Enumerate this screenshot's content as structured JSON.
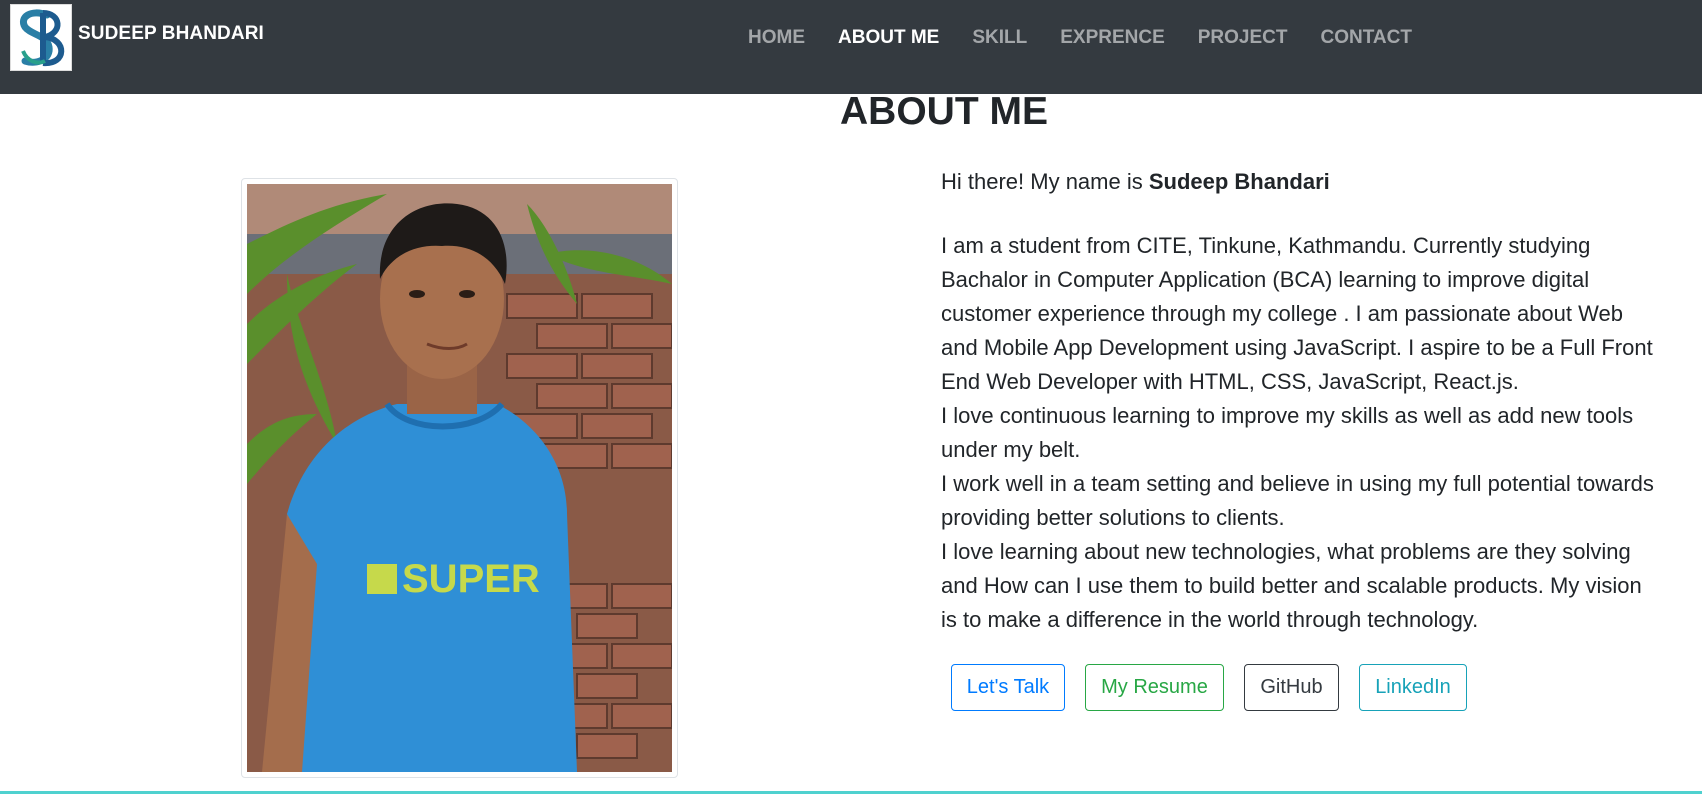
{
  "nav": {
    "brand": "SUDEEP BHANDARI",
    "logo_icon": "sb-monogram-logo",
    "links": [
      "HOME",
      "ABOUT ME",
      "SKILL",
      "EXPRENCE",
      "PROJECT",
      "CONTACT"
    ],
    "active": "ABOUT ME"
  },
  "about": {
    "title": "ABOUT ME",
    "greeting_prefix": "Hi there! My name is ",
    "greeting_name": "Sudeep Bhandari",
    "paragraphs": [
      "I am a student from CITE, Tinkune, Kathmandu. Currently studying Bachalor in Computer Application (BCA) learning to improve digital customer experience through my college . I am passionate about Web and Mobile App Development using JavaScript. I aspire to be a Full Front End Web Developer with HTML, CSS, JavaScript, React.js.",
      "I love continuous learning to improve my skills as well as add new tools under my belt.",
      "I work well in a team setting and believe in using my full potential towards providing better solutions to clients.",
      "I love learning about new technologies, what problems are they solving and How can I use them to build better and scalable products. My vision is to make a difference in the world through technology."
    ],
    "photo": "profile-photo"
  },
  "buttons": {
    "talk": "Let's Talk",
    "resume": "My Resume",
    "github": "GitHub",
    "linkedin": "LinkedIn"
  },
  "colors": {
    "navbar_bg": "#343a40",
    "primary": "#007bff",
    "success": "#28a745",
    "dark": "#343a40",
    "info": "#17a2b8",
    "bottom_line": "#4fd1cf"
  }
}
